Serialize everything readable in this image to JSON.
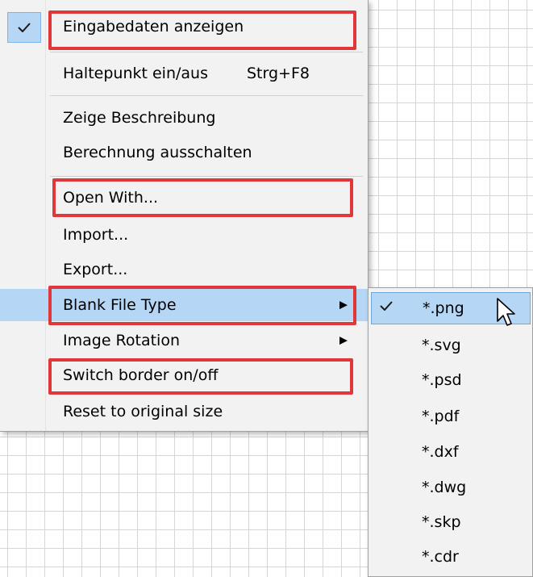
{
  "context_menu": {
    "items": [
      {
        "label": "Eingabedaten anzeigen",
        "checked": true
      },
      {
        "label": "Haltepunkt ein/aus",
        "shortcut": "Strg+F8"
      },
      {
        "label": "Zeige Beschreibung"
      },
      {
        "label": "Berechnung ausschalten"
      },
      {
        "label": "Open With..."
      },
      {
        "label": "Import..."
      },
      {
        "label": "Export..."
      },
      {
        "label": "Blank File Type",
        "has_submenu": true,
        "highlighted": true
      },
      {
        "label": "Image Rotation",
        "has_submenu": true
      },
      {
        "label": "Switch border on/off"
      },
      {
        "label": "Reset to original size"
      }
    ]
  },
  "submenu": {
    "items": [
      {
        "label": "*.png",
        "checked": true,
        "highlighted": true
      },
      {
        "label": "*.svg"
      },
      {
        "label": "*.psd"
      },
      {
        "label": "*.pdf"
      },
      {
        "label": "*.dxf"
      },
      {
        "label": "*.dwg"
      },
      {
        "label": "*.skp"
      },
      {
        "label": "*.cdr"
      }
    ]
  },
  "colors": {
    "menu_background": "#f2f2f2",
    "highlight": "#b6d6f6",
    "annotation_box": "#e0383a",
    "grid_line": "#d6d6d6"
  },
  "icons": {
    "check": "checkmark-icon",
    "submenu_arrow": "chevron-right-icon",
    "cursor": "mouse-pointer-icon"
  }
}
